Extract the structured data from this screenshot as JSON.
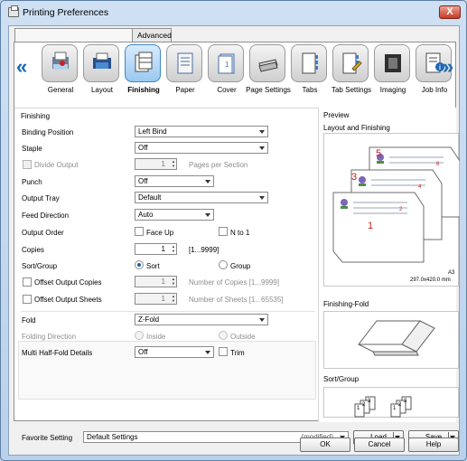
{
  "window": {
    "title": "Printing Preferences",
    "close_label": "X"
  },
  "tabs": [
    "",
    "Advanced"
  ],
  "toolbar": {
    "items": [
      {
        "label": "General",
        "icon": "general-icon"
      },
      {
        "label": "Layout",
        "icon": "layout-icon"
      },
      {
        "label": "Finishing",
        "icon": "finishing-icon",
        "selected": true
      },
      {
        "label": "Paper",
        "icon": "paper-icon"
      },
      {
        "label": "Cover",
        "icon": "cover-icon"
      },
      {
        "label": "Page Settings",
        "icon": "page-settings-icon"
      },
      {
        "label": "Tabs",
        "icon": "tabs-icon"
      },
      {
        "label": "Tab Settings",
        "icon": "tab-settings-icon"
      },
      {
        "label": "Imaging",
        "icon": "imaging-icon"
      },
      {
        "label": "Job Info",
        "icon": "job-info-icon"
      }
    ]
  },
  "finishing": {
    "section_title": "Finishing",
    "binding_position": {
      "label": "Binding Position",
      "value": "Left Bind"
    },
    "staple": {
      "label": "Staple",
      "value": "Off"
    },
    "divide_output": {
      "label": "Divide Output",
      "value": "1",
      "suffix": "Pages per Section"
    },
    "punch": {
      "label": "Punch",
      "value": "Off"
    },
    "output_tray": {
      "label": "Output Tray",
      "value": "Default"
    },
    "feed_direction": {
      "label": "Feed Direction",
      "value": "Auto"
    },
    "output_order": {
      "label": "Output Order",
      "face_up": "Face Up",
      "n_to_1": "N to 1"
    },
    "copies": {
      "label": "Copies",
      "value": "1",
      "range": "[1...9999]"
    },
    "sort_group": {
      "label": "Sort/Group",
      "sort": "Sort",
      "group": "Group"
    },
    "offset_output_copies": {
      "label": "Offset Output Copies",
      "value": "1",
      "suffix": "Number of Copies [1...9999]"
    },
    "offset_output_sheets": {
      "label": "Offset Output Sheets",
      "value": "1",
      "suffix": "Number of Sheets [1...65535]"
    },
    "fold": {
      "label": "Fold",
      "value": "Z-Fold"
    },
    "folding_direction": {
      "label": "Folding Direction",
      "inside": "Inside",
      "outside": "Outside"
    },
    "multi_half_fold": {
      "label": "Multi Half-Fold Details",
      "value": "Off",
      "trim": "Trim"
    }
  },
  "preview": {
    "title": "Preview",
    "layout_title": "Layout and Finishing",
    "paper_size": "A3",
    "paper_dims": "297.0x420.0 mm",
    "page_numbers": [
      "5",
      "3",
      "1"
    ],
    "side_numbers": [
      "6",
      "4",
      "2"
    ],
    "finishing_fold_title": "Finishing-Fold",
    "sort_group_title": "Sort/Group",
    "sort_numbers": [
      "1",
      "2",
      "3",
      "1",
      "2",
      "3"
    ]
  },
  "favorite": {
    "label": "Favorite Setting",
    "value": "Default Settings",
    "modified": "(modified)",
    "load": "Load",
    "save": "Save"
  },
  "buttons": {
    "ok": "OK",
    "cancel": "Cancel",
    "help": "Help"
  },
  "colors": {
    "accent": "#1a68b3",
    "selected": "#3f86c7",
    "page_number": "#c11f1f"
  }
}
